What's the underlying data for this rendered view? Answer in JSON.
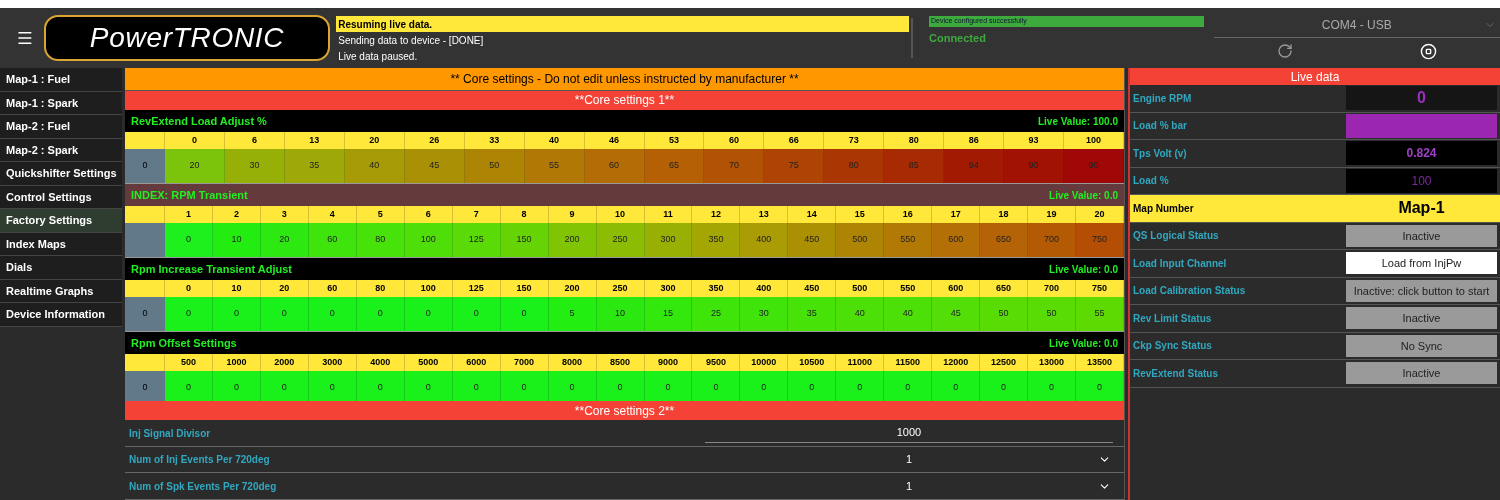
{
  "header": {
    "logo": "PowerTRONIC",
    "messages": [
      {
        "text": "Resuming live data.",
        "highlighted": true
      },
      {
        "text": "Sending data to device - [DONE]",
        "highlighted": false
      },
      {
        "text": "Live data paused.",
        "highlighted": false
      }
    ],
    "device_message": "Device configured successfully",
    "connection": "Connected",
    "port": "COM4 - USB"
  },
  "sidebar": {
    "items": [
      {
        "label": "Map-1 : Fuel",
        "selected": false
      },
      {
        "label": "Map-1 : Spark",
        "selected": false
      },
      {
        "label": "Map-2 : Fuel",
        "selected": false
      },
      {
        "label": "Map-2 : Spark",
        "selected": false
      },
      {
        "label": "Quickshifter Settings",
        "selected": false
      },
      {
        "label": "Control Settings",
        "selected": false
      },
      {
        "label": "Factory Settings",
        "selected": true
      },
      {
        "label": "Index Maps",
        "selected": false
      },
      {
        "label": "Dials",
        "selected": false
      },
      {
        "label": "Realtime Graphs",
        "selected": false
      },
      {
        "label": "Device Information",
        "selected": false
      }
    ]
  },
  "warning": "** Core settings - Do not edit unless instructed by manufacturer **",
  "section_1": "**Core settings 1**",
  "tables": [
    {
      "title": "RevExtend Load Adjust %",
      "highlighted": false,
      "live_value": "Live Value: 100.0",
      "row_label": "0",
      "columns": [
        "0",
        "6",
        "13",
        "20",
        "26",
        "33",
        "40",
        "46",
        "53",
        "60",
        "66",
        "73",
        "80",
        "86",
        "93",
        "100"
      ],
      "cells": [
        {
          "value": "20",
          "color": "#7cc40c"
        },
        {
          "value": "30",
          "color": "#96b008"
        },
        {
          "value": "35",
          "color": "#9ea808"
        },
        {
          "value": "40",
          "color": "#a69a06"
        },
        {
          "value": "45",
          "color": "#aa9004"
        },
        {
          "value": "50",
          "color": "#ae8404"
        },
        {
          "value": "55",
          "color": "#b27806"
        },
        {
          "value": "60",
          "color": "#b46c06"
        },
        {
          "value": "65",
          "color": "#b66006"
        },
        {
          "value": "70",
          "color": "#b25204"
        },
        {
          "value": "75",
          "color": "#ae4404"
        },
        {
          "value": "80",
          "color": "#aa3604"
        },
        {
          "value": "85",
          "color": "#a82a02"
        },
        {
          "value": "94",
          "color": "#a21a02"
        },
        {
          "value": "90",
          "color": "#a21202"
        },
        {
          "value": "90",
          "color": "#a00808"
        }
      ]
    },
    {
      "title": "INDEX: RPM Transient",
      "highlighted": true,
      "live_value": "Live Value: 0.0",
      "columns": [
        "1",
        "2",
        "3",
        "4",
        "5",
        "6",
        "7",
        "8",
        "9",
        "10",
        "11",
        "12",
        "13",
        "14",
        "15",
        "16",
        "17",
        "18",
        "19",
        "20"
      ],
      "cells": [
        {
          "value": "0",
          "color": "#1ef01e"
        },
        {
          "value": "10",
          "color": "#22ec10"
        },
        {
          "value": "20",
          "color": "#2ee812"
        },
        {
          "value": "60",
          "color": "#3ee40c"
        },
        {
          "value": "80",
          "color": "#46e20a"
        },
        {
          "value": "100",
          "color": "#50de08"
        },
        {
          "value": "125",
          "color": "#5ada06"
        },
        {
          "value": "150",
          "color": "#66d404"
        },
        {
          "value": "200",
          "color": "#80c404"
        },
        {
          "value": "250",
          "color": "#8cbc04"
        },
        {
          "value": "300",
          "color": "#98b004"
        },
        {
          "value": "350",
          "color": "#a4a604"
        },
        {
          "value": "400",
          "color": "#aa9c04"
        },
        {
          "value": "450",
          "color": "#ac9004"
        },
        {
          "value": "500",
          "color": "#ae8404"
        },
        {
          "value": "550",
          "color": "#b27a04"
        },
        {
          "value": "600",
          "color": "#b47006"
        },
        {
          "value": "650",
          "color": "#b46406"
        },
        {
          "value": "700",
          "color": "#b45a04"
        },
        {
          "value": "750",
          "color": "#b44e04"
        }
      ]
    },
    {
      "title": "Rpm Increase Transient Adjust",
      "highlighted": false,
      "live_value": "Live Value: 0.0",
      "row_label": "0",
      "columns": [
        "0",
        "10",
        "20",
        "60",
        "80",
        "100",
        "125",
        "150",
        "200",
        "250",
        "300",
        "350",
        "400",
        "450",
        "500",
        "550",
        "600",
        "650",
        "700",
        "750"
      ],
      "cells": [
        {
          "value": "0",
          "color": "#1af01a"
        },
        {
          "value": "0",
          "color": "#1af01a"
        },
        {
          "value": "0",
          "color": "#1af01a"
        },
        {
          "value": "0",
          "color": "#1af01a"
        },
        {
          "value": "0",
          "color": "#1af01a"
        },
        {
          "value": "0",
          "color": "#1af01a"
        },
        {
          "value": "0",
          "color": "#1af01a"
        },
        {
          "value": "0",
          "color": "#1af01a"
        },
        {
          "value": "5",
          "color": "#22ee12"
        },
        {
          "value": "10",
          "color": "#2ae810"
        },
        {
          "value": "15",
          "color": "#32e80c"
        },
        {
          "value": "25",
          "color": "#3ee40a"
        },
        {
          "value": "30",
          "color": "#40e40a"
        },
        {
          "value": "35",
          "color": "#46e208"
        },
        {
          "value": "40",
          "color": "#4ce008"
        },
        {
          "value": "40",
          "color": "#4ce008"
        },
        {
          "value": "45",
          "color": "#52de06"
        },
        {
          "value": "50",
          "color": "#58dc04"
        },
        {
          "value": "50",
          "color": "#58dc04"
        },
        {
          "value": "55",
          "color": "#5cda02"
        }
      ]
    },
    {
      "title": "Rpm Offset Settings",
      "highlighted": false,
      "live_value": "Live Value: 0.0",
      "row_label": "0",
      "columns": [
        "500",
        "1000",
        "2000",
        "3000",
        "4000",
        "5000",
        "6000",
        "7000",
        "8000",
        "8500",
        "9000",
        "9500",
        "10000",
        "10500",
        "11000",
        "11500",
        "12000",
        "12500",
        "13000",
        "13500"
      ],
      "cells": [
        {
          "value": "0",
          "color": "#1af01a"
        },
        {
          "value": "0",
          "color": "#1af01a"
        },
        {
          "value": "0",
          "color": "#1af01a"
        },
        {
          "value": "0",
          "color": "#1af01a"
        },
        {
          "value": "0",
          "color": "#1af01a"
        },
        {
          "value": "0",
          "color": "#1af01a"
        },
        {
          "value": "0",
          "color": "#1af01a"
        },
        {
          "value": "0",
          "color": "#1af01a"
        },
        {
          "value": "0",
          "color": "#1af01a"
        },
        {
          "value": "0",
          "color": "#1af01a"
        },
        {
          "value": "0",
          "color": "#1af01a"
        },
        {
          "value": "0",
          "color": "#1af01a"
        },
        {
          "value": "0",
          "color": "#1af01a"
        },
        {
          "value": "0",
          "color": "#1af01a"
        },
        {
          "value": "0",
          "color": "#1af01a"
        },
        {
          "value": "0",
          "color": "#1af01a"
        },
        {
          "value": "0",
          "color": "#1af01a"
        },
        {
          "value": "0",
          "color": "#1af01a"
        },
        {
          "value": "0",
          "color": "#1af01a"
        },
        {
          "value": "0",
          "color": "#1af01a"
        }
      ]
    }
  ],
  "section_2": "**Core settings 2**",
  "settings": [
    {
      "label": "Inj Signal Divisor",
      "value": "1000",
      "kind": "text"
    },
    {
      "label": "Num of Inj Events Per 720deg",
      "value": "1",
      "kind": "dropdown"
    },
    {
      "label": "Num of Spk Events Per 720deg",
      "value": "1",
      "kind": "dropdown"
    }
  ],
  "live_data": {
    "title": "Live data",
    "rows": [
      {
        "label": "Engine RPM",
        "value": "0",
        "kind": "big"
      },
      {
        "label": "Load % bar",
        "kind": "bar",
        "level": 1
      },
      {
        "label": "Tps Volt (v)",
        "value": "0.824",
        "kind": "readout"
      },
      {
        "label": "Load %",
        "value": "100",
        "kind": "dim"
      },
      {
        "label": "Map Number",
        "value": "Map-1",
        "kind": "highlight"
      },
      {
        "label": "QS Logical Status",
        "value": "Inactive",
        "kind": "status"
      },
      {
        "label": "Load Input Channel",
        "value": "Load from InjPw",
        "kind": "input"
      },
      {
        "label": "Load Calibration Status",
        "value": "Inactive: click button to start",
        "kind": "status"
      },
      {
        "label": "Rev Limit Status",
        "value": "Inactive",
        "kind": "status"
      },
      {
        "label": "Ckp Sync Status",
        "value": "No Sync",
        "kind": "status"
      },
      {
        "label": "RevExtend Status",
        "value": "Inactive",
        "kind": "status"
      }
    ]
  }
}
